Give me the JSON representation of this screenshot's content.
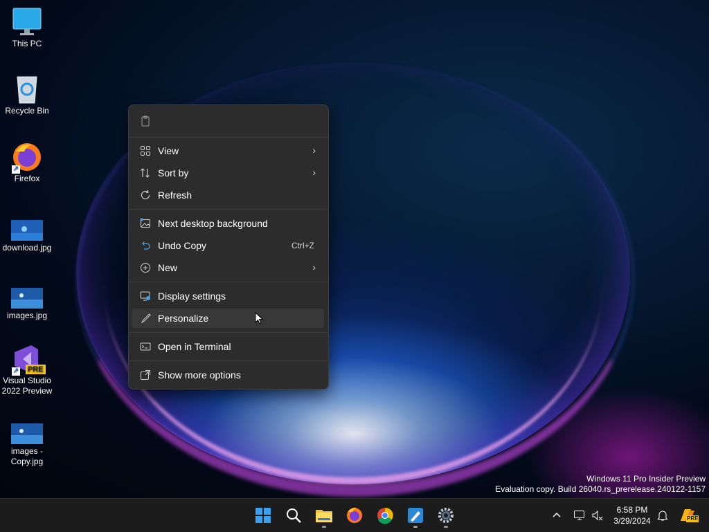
{
  "desktop": {
    "icons": [
      {
        "label": "This PC"
      },
      {
        "label": "Recycle Bin"
      },
      {
        "label": "Firefox"
      },
      {
        "label": "download.jpg"
      },
      {
        "label": "images.jpg"
      },
      {
        "label": "Visual Studio 2022 Preview"
      },
      {
        "label": "images - Copy.jpg"
      }
    ],
    "vs_badge": "PRE"
  },
  "context_menu": {
    "items": [
      {
        "label": "View",
        "icon": "grid-icon",
        "submenu": true
      },
      {
        "label": "Sort by",
        "icon": "sort-icon",
        "submenu": true
      },
      {
        "label": "Refresh",
        "icon": "refresh-icon"
      },
      {
        "label": "Next desktop background",
        "icon": "image-icon"
      },
      {
        "label": "Undo Copy",
        "icon": "undo-icon",
        "shortcut": "Ctrl+Z"
      },
      {
        "label": "New",
        "icon": "plus-circle-icon",
        "submenu": true
      },
      {
        "label": "Display settings",
        "icon": "monitor-gear-icon"
      },
      {
        "label": "Personalize",
        "icon": "brush-icon",
        "hovered": true
      },
      {
        "label": "Open in Terminal",
        "icon": "terminal-icon"
      },
      {
        "label": "Show more options",
        "icon": "expand-icon"
      }
    ]
  },
  "watermark": {
    "line1": "Windows 11 Pro Insider Preview",
    "line2": "Evaluation copy. Build 26040.rs_prerelease.240122-1157"
  },
  "taskbar": {
    "apps": [
      "start-icon",
      "search-icon",
      "file-explorer-icon",
      "firefox-icon",
      "chrome-icon",
      "paint-icon",
      "settings-icon"
    ],
    "clock": {
      "time": "6:58 PM",
      "date": "3/29/2024"
    },
    "copilot_badge": "PRE"
  },
  "colors": {
    "menu_bg": "#2c2c2c",
    "taskbar_bg": "#1c1c1c",
    "accent": "#0078d4"
  }
}
